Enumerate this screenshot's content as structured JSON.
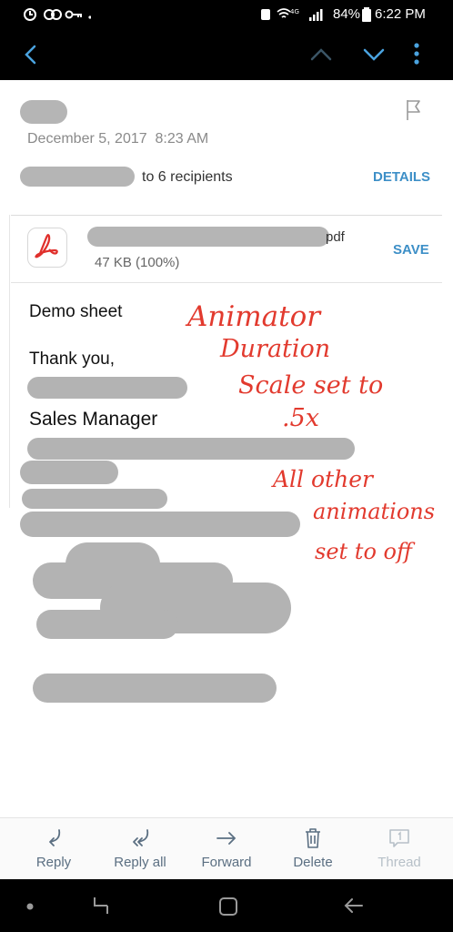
{
  "status_bar": {
    "battery": "84%",
    "time": "6:22 PM"
  },
  "header": {
    "date": "December 5, 2017",
    "time": "8:23 AM",
    "recipients_text": "to 6 recipients",
    "details_label": "DETAILS"
  },
  "attachment": {
    "ext": "pdf",
    "size": "47 KB (100%)",
    "save_label": "SAVE"
  },
  "body": {
    "line1": "Demo sheet",
    "line2": "Thank you,",
    "title": "Sales Manager"
  },
  "annotation": {
    "lines": [
      "Animator",
      "Duration",
      "Scale set to",
      ".5x",
      "All other",
      "animations",
      "set to off"
    ],
    "color": "#e23a2e"
  },
  "toolbar": {
    "reply": "Reply",
    "reply_all": "Reply all",
    "forward": "Forward",
    "delete": "Delete",
    "thread": "Thread"
  },
  "colors": {
    "accent": "#3d8fc7",
    "icon": "#5b6f82"
  }
}
